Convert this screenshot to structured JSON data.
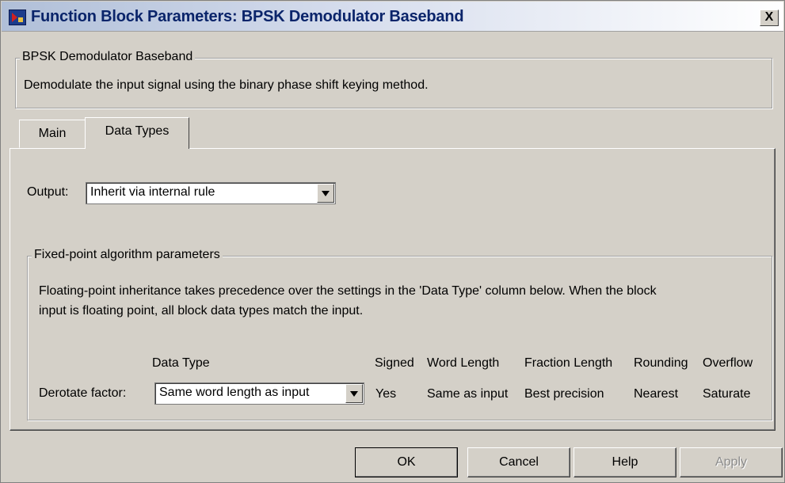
{
  "window": {
    "title": "Function Block Parameters: BPSK Demodulator Baseband",
    "close_label": "X"
  },
  "block_group": {
    "legend": "BPSK Demodulator Baseband",
    "description": "Demodulate the input signal using the binary phase shift keying method."
  },
  "tabs": [
    {
      "label": "Main",
      "active": false
    },
    {
      "label": "Data Types",
      "active": true
    }
  ],
  "output": {
    "label": "Output:",
    "value": "Inherit via internal rule"
  },
  "fixed_point": {
    "legend": "Fixed-point algorithm parameters",
    "note_line1": "Floating-point inheritance takes precedence over the settings in the 'Data Type' column below. When the block",
    "note_line2": "input is floating point, all block data types match the input.",
    "headers": {
      "data_type": "Data Type",
      "signed": "Signed",
      "word_length": "Word Length",
      "fraction_length": "Fraction Length",
      "rounding": "Rounding",
      "overflow": "Overflow"
    },
    "row": {
      "name": "Derotate factor:",
      "data_type": "Same word length as input",
      "signed": "Yes",
      "word_length": "Same as input",
      "fraction_length": "Best precision",
      "rounding": "Nearest",
      "overflow": "Saturate"
    }
  },
  "buttons": {
    "ok": "OK",
    "cancel": "Cancel",
    "help": "Help",
    "apply": "Apply"
  }
}
